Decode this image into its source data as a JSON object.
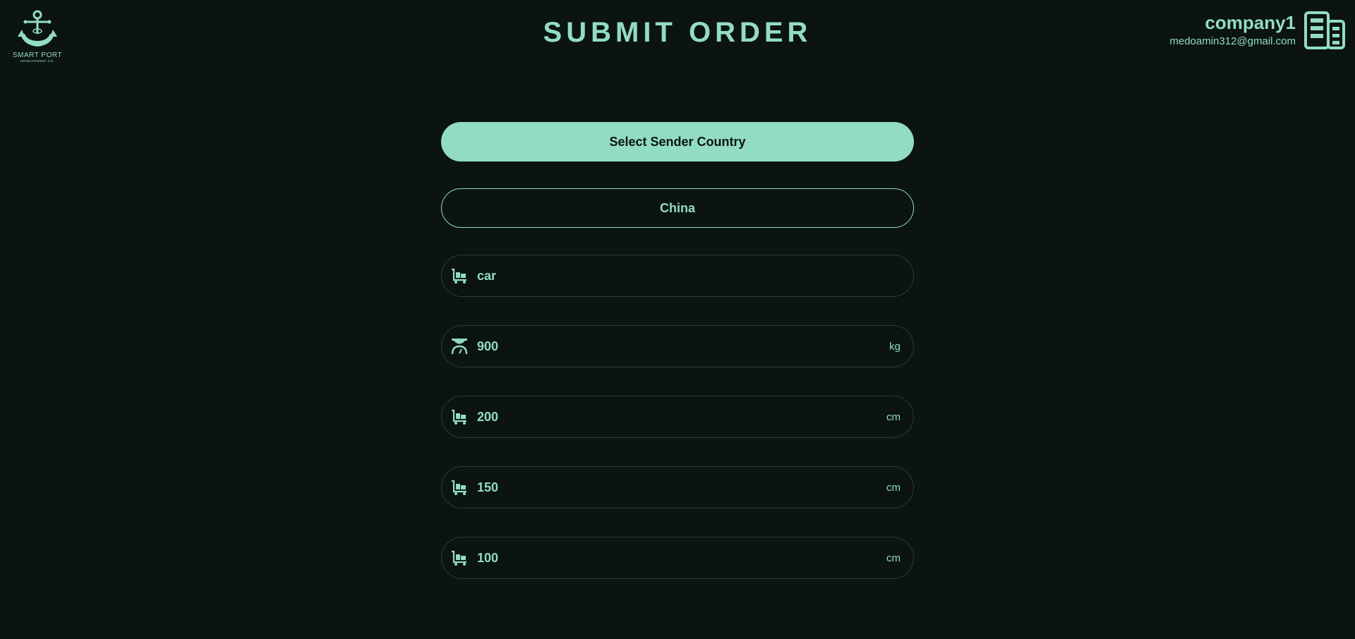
{
  "logo": {
    "title": "SMART PORT",
    "subtitle": "DEVELOPMENT CO."
  },
  "header": {
    "title": "SUBMIT ORDER"
  },
  "user": {
    "name": "company1",
    "email": "medoamin312@gmail.com",
    "icon": "building-icon"
  },
  "form": {
    "sender_country_button": "Select Sender Country",
    "selected_country": "China",
    "fields": [
      {
        "icon": "cart-icon",
        "value": "car",
        "unit": ""
      },
      {
        "icon": "scale-icon",
        "value": "900",
        "unit": "kg"
      },
      {
        "icon": "cart-icon",
        "value": "200",
        "unit": "cm"
      },
      {
        "icon": "cart-icon",
        "value": "150",
        "unit": "cm"
      },
      {
        "icon": "cart-icon",
        "value": "100",
        "unit": "cm"
      }
    ]
  },
  "colors": {
    "background": "#0b1412",
    "accent": "#93dcc4",
    "border": "#2c3a36"
  }
}
